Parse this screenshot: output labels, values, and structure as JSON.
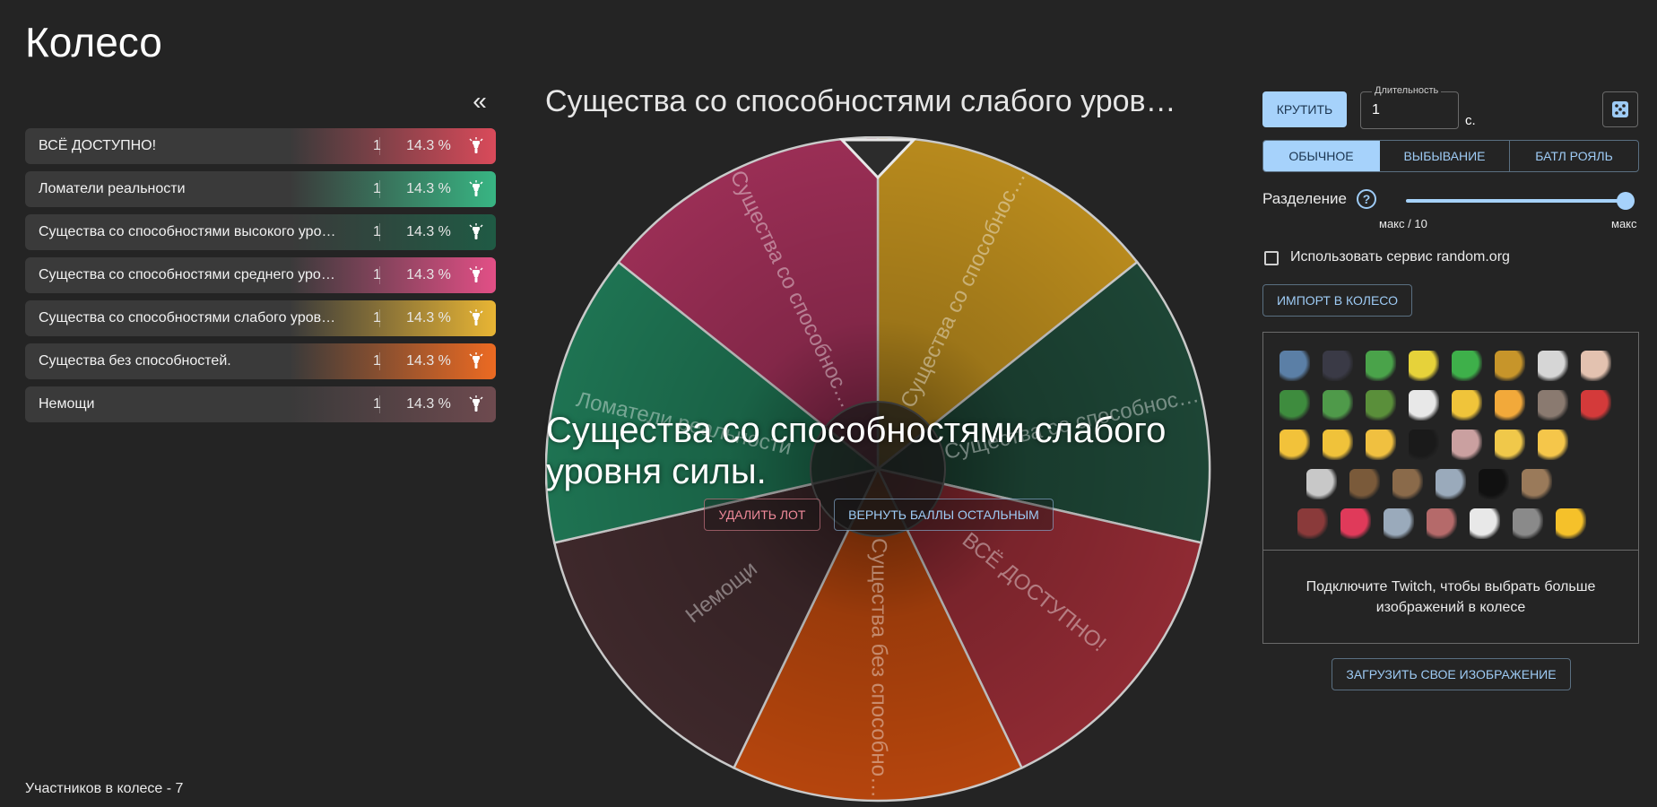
{
  "page": {
    "title": "Колесо"
  },
  "sidebar": {
    "collapse_label": "«",
    "lots": [
      {
        "name": "ВСЁ ДОСТУПНО!",
        "amount": "1",
        "percent": "14.3 %",
        "color": "#d94a5a"
      },
      {
        "name": "Ломатели реальности",
        "amount": "1",
        "percent": "14.3 %",
        "color": "#38b583"
      },
      {
        "name": "Существа со способностями высокого уро…",
        "amount": "1",
        "percent": "14.3 %",
        "color": "#1f5a44"
      },
      {
        "name": "Существа со способностями среднего уро…",
        "amount": "1",
        "percent": "14.3 %",
        "color": "#e24f86"
      },
      {
        "name": "Существа со способностями слабого уров…",
        "amount": "1",
        "percent": "14.3 %",
        "color": "#e8b534"
      },
      {
        "name": "Существа без способностей.",
        "amount": "1",
        "percent": "14.3 %",
        "color": "#ec6a22"
      },
      {
        "name": "Немощи",
        "amount": "1",
        "percent": "14.3 %",
        "color": "#6e4a4f"
      }
    ],
    "participants_label": "Участников в колесе - 7"
  },
  "wheel": {
    "title": "Существа со способностями слабого уров…",
    "segments": [
      {
        "label": "Существа со способнос…",
        "color": "#b88a1d"
      },
      {
        "label": "Существа со способнос…",
        "color": "#1d4535"
      },
      {
        "label": "ВСЁ ДОСТУПНО!",
        "color": "#8f2a33"
      },
      {
        "label": "Существа без способно…",
        "color": "#b5450d"
      },
      {
        "label": "Немощи",
        "color": "#3e282b"
      },
      {
        "label": "Ломатели реальности",
        "color": "#1e7352"
      },
      {
        "label": "Существа со способнос…",
        "color": "#9a2e55"
      }
    ],
    "winner": "Существа со способностями слабого уровня силы.",
    "delete_label": "УДАЛИТЬ ЛОТ",
    "return_label": "ВЕРНУТЬ БАЛЛЫ ОСТАЛЬНЫМ"
  },
  "controls": {
    "spin_label": "КРУТИТЬ",
    "duration_label": "Длительность",
    "duration_value": "1",
    "duration_unit": "с.",
    "modes": [
      {
        "label": "ОБЫЧНОЕ",
        "active": true
      },
      {
        "label": "ВЫБЫВАНИЕ",
        "active": false
      },
      {
        "label": "БАТЛ РОЯЛЬ",
        "active": false
      }
    ],
    "split_label": "Разделение",
    "split_help": "?",
    "split_value": 1.0,
    "split_min_label": "макс / 10",
    "split_max_label": "макс",
    "random_org_label": "Использовать сервис random.org",
    "random_org_checked": false,
    "import_label": "ИМПОРТ В КОЛЕСО",
    "twitch_text": "Подключите Twitch, чтобы выбрать больше изображений в колесе",
    "upload_label": "ЗАГРУЗИТЬ СВОЕ ИЗОБРАЖЕНИЕ"
  },
  "colors": {
    "accent": "#a6d2fb",
    "accent_text": "#9ecbf5",
    "background": "#242424"
  },
  "emotes": {
    "rows": [
      [
        "#5b7fa6",
        "#3a3a46",
        "#4aa34a",
        "#e6d23a",
        "#3eb04a",
        "#c7952a",
        "#d6d6d6",
        "#e3c2b0"
      ],
      [
        "#3e8c3e",
        "#4f9a4a",
        "#5a8f3a",
        "#e8e8e8",
        "#f0c43a",
        "#f2a93a",
        "#8a7a70",
        "#d43a3a"
      ],
      [
        "#f2c23a",
        "#f0c23a",
        "#f0c040",
        "#1a1a1a",
        "#caa0a0",
        "#f0c84a",
        "#f5c64a"
      ],
      [
        "#c8c8c8",
        "#7a5a3a",
        "#8a6a4a",
        "#9aaabb",
        "#111111",
        "#9a7a5a"
      ],
      [
        "#8a3a3a",
        "#e03a5a",
        "#9aaabb",
        "#b56a6a",
        "#e8e8e8",
        "#8a8a8a",
        "#f5c12a"
      ]
    ]
  }
}
